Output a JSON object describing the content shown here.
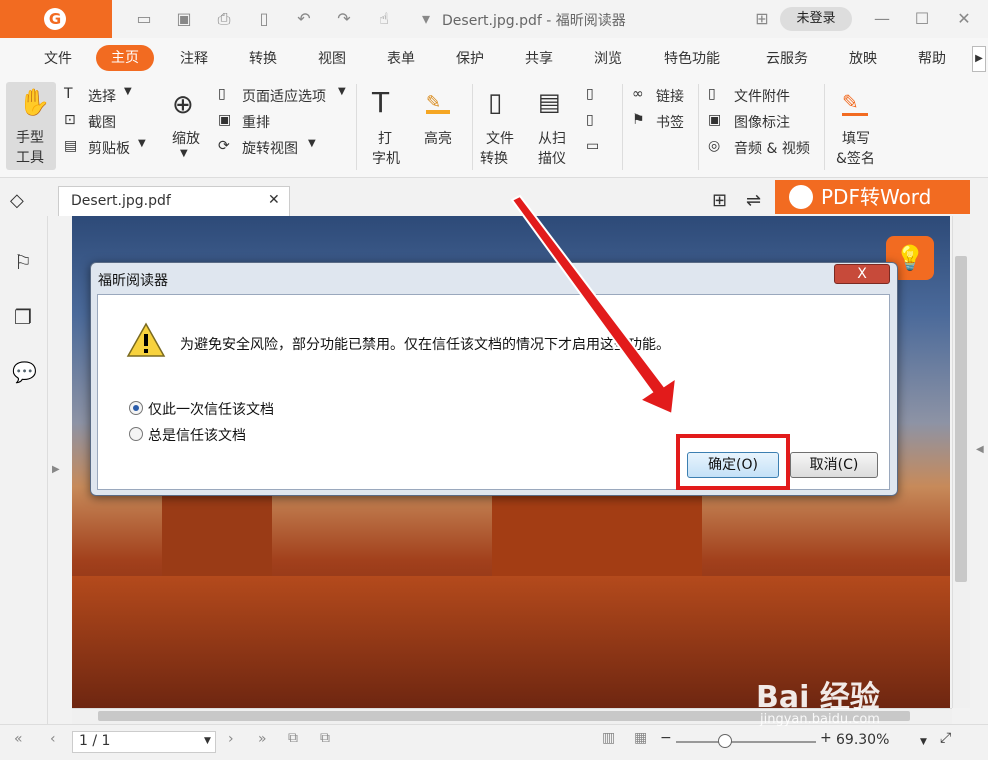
{
  "app": {
    "doc_title": "Desert.jpg.pdf - 福昕阅读器",
    "login": "未登录",
    "logo_letter": "G"
  },
  "menu": [
    "文件",
    "主页",
    "注释",
    "转换",
    "视图",
    "表单",
    "保护",
    "共享",
    "浏览",
    "特色功能",
    "云服务",
    "放映",
    "帮助"
  ],
  "ribbon": {
    "hand_tool": [
      "手型",
      "工具"
    ],
    "select": "选择",
    "screenshot": "截图",
    "clipboard": "剪贴板",
    "zoom": "缩放",
    "fit_options": "页面适应选项",
    "reflow": "重排",
    "rotate_view": "旋转视图",
    "typewriter": [
      "打",
      "字机"
    ],
    "highlight": "高亮",
    "file_convert": [
      "文件",
      "转换"
    ],
    "from_scanner": [
      "从扫",
      "描仪"
    ],
    "link": "链接",
    "bookmark": "书签",
    "file_attachment": "文件附件",
    "image_annotation": "图像标注",
    "audio_video": "音频 & 视频",
    "fill_sign": [
      "填写",
      "&签名"
    ]
  },
  "tab": {
    "label": "Desert.jpg.pdf"
  },
  "pdf2word": "PDF转Word",
  "dialog": {
    "title": "福昕阅读器",
    "close": "X",
    "message": "为避免安全风险，部分功能已禁用。仅在信任该文档的情况下才启用这些功能。",
    "option1": "仅此一次信任该文档",
    "option2": "总是信任该文档",
    "ok": "确定(O)",
    "cancel": "取消(C)"
  },
  "status": {
    "page": "1 / 1",
    "zoom": "69.30%"
  },
  "watermark": {
    "main": "Bai 经验",
    "sub": "jingyan.baidu.com"
  },
  "colors": {
    "brand": "#f26b21",
    "highlight_box": "#e21b1b"
  }
}
